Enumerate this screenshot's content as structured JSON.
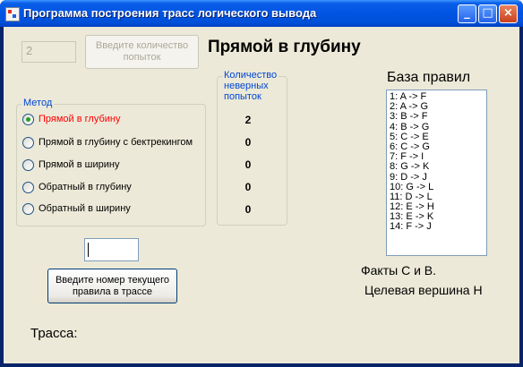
{
  "window": {
    "title": "Программа построения трасс логического вывода",
    "controls": {
      "minimize": "_",
      "maximize": "□",
      "close": "×"
    }
  },
  "attempts": {
    "input_value": "2",
    "button_label_line1": "Введите количество",
    "button_label_line2": "попыток"
  },
  "current_method_title": "Прямой в глубину",
  "method_group": {
    "legend": "Метод",
    "options": [
      {
        "label": "Прямой в глубину",
        "checked": true
      },
      {
        "label": "Прямой в глубину с бектрекингом",
        "checked": false
      },
      {
        "label": "Прямой в ширину",
        "checked": false
      },
      {
        "label": "Обратный в глубину",
        "checked": false
      },
      {
        "label": "Обратный в ширину",
        "checked": false
      }
    ]
  },
  "failed_attempts": {
    "legend_line1": "Количество",
    "legend_line2": "неверных",
    "legend_line3": "попыток",
    "values": [
      "2",
      "0",
      "0",
      "0",
      "0"
    ]
  },
  "rules": {
    "heading": "База правил",
    "items": [
      "1: A -> F",
      "2: A -> G",
      "3: B -> F",
      "4: B -> G",
      "5: C -> E",
      "6: C -> G",
      "7: F -> I",
      "8: G -> K",
      "9: D -> J",
      "10: G -> L",
      "11: D -> L",
      "12: E -> H",
      "13: E -> K",
      "14: F -> J"
    ]
  },
  "facts_text": "Факты C и B.",
  "goal_text": "Целевая вершина H",
  "rule_number": {
    "input_value": "",
    "button_label_line1": "Введите номер текущего",
    "button_label_line2": "правила в трассе"
  },
  "trace_label": "Трасса:"
}
